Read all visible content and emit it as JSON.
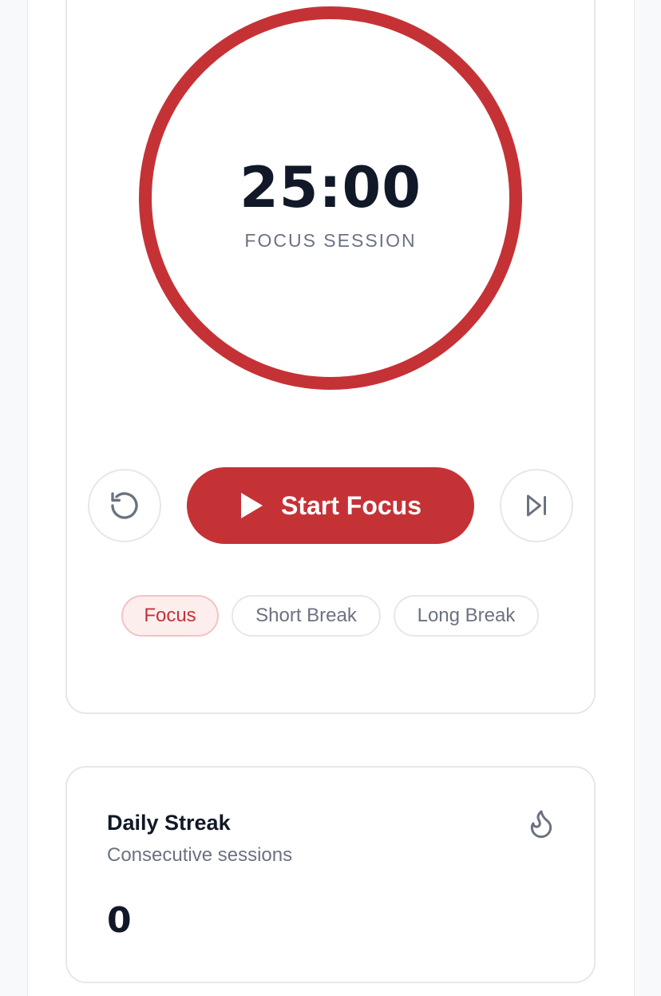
{
  "timer": {
    "time": "25:00",
    "label": "FOCUS SESSION",
    "ring_color": "#c53236"
  },
  "controls": {
    "reset_icon": "reset-icon",
    "start_label": "Start Focus",
    "start_icon": "play-icon",
    "skip_icon": "skip-forward-icon"
  },
  "modes": [
    {
      "label": "Focus",
      "active": true
    },
    {
      "label": "Short Break",
      "active": false
    },
    {
      "label": "Long Break",
      "active": false
    }
  ],
  "streak": {
    "title": "Daily Streak",
    "subtitle": "Consecutive sessions",
    "count": "0",
    "icon": "flame-icon"
  },
  "colors": {
    "accent": "#c53236",
    "text_primary": "#111827",
    "text_secondary": "#6b7280",
    "border": "#e5e7eb"
  }
}
